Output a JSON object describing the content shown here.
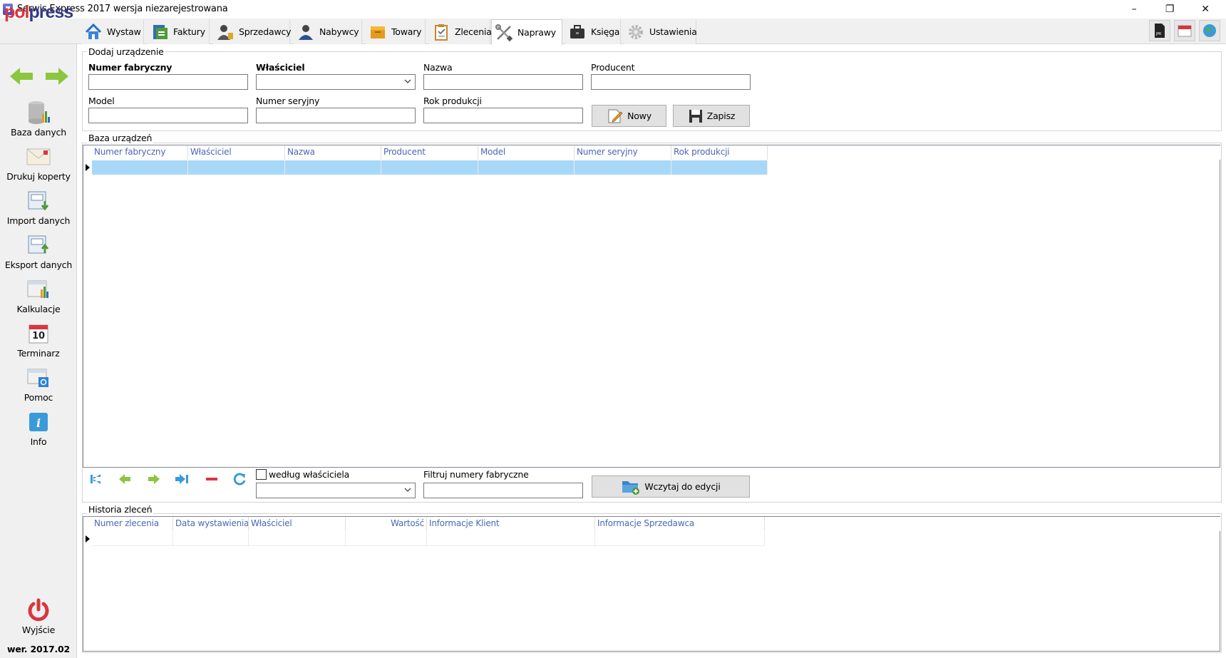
{
  "window": {
    "title": "Serwis Express 2017 wersja niezarejestrowana",
    "controls": {
      "minimize": "–",
      "restore": "❐",
      "close": "✕"
    }
  },
  "logo": {
    "part1": "pol",
    "part2": "press"
  },
  "tabs": [
    {
      "label": "Wystaw",
      "icon": "home-icon"
    },
    {
      "label": "Faktury",
      "icon": "invoice-icon"
    },
    {
      "label": "Sprzedawcy",
      "icon": "seller-icon"
    },
    {
      "label": "Nabywcy",
      "icon": "buyer-icon"
    },
    {
      "label": "Towary",
      "icon": "goods-icon"
    },
    {
      "label": "Zlecenia",
      "icon": "clipboard-icon"
    },
    {
      "label": "Naprawy",
      "icon": "tools-icon",
      "active": true
    },
    {
      "label": "Księga",
      "icon": "briefcase-icon"
    },
    {
      "label": "Ustawienia",
      "icon": "gear-icon"
    }
  ],
  "top_right_icons": [
    "jpk-icon",
    "calendar-icon",
    "globe-icon"
  ],
  "sidebar": {
    "items": [
      {
        "label": "Baza danych",
        "icon": "database-icon"
      },
      {
        "label": "Drukuj koperty",
        "icon": "envelope-icon"
      },
      {
        "label": "Import danych",
        "icon": "import-icon"
      },
      {
        "label": "Eksport danych",
        "icon": "export-icon"
      },
      {
        "label": "Kalkulacje",
        "icon": "calculator-icon"
      },
      {
        "label": "Terminarz",
        "icon": "calendar-day-icon",
        "day": "10"
      },
      {
        "label": "Pomoc",
        "icon": "help-icon"
      },
      {
        "label": "Info",
        "icon": "info-icon"
      }
    ],
    "exit_label": "Wyjście",
    "version": "wer. 2017.02"
  },
  "add_device": {
    "title": "Dodaj urządzenie",
    "fields": {
      "serial_factory": {
        "label": "Numer fabryczny",
        "value": ""
      },
      "owner": {
        "label": "Właściciel",
        "value": ""
      },
      "name": {
        "label": "Nazwa",
        "value": ""
      },
      "producer": {
        "label": "Producent",
        "value": ""
      },
      "model": {
        "label": "Model",
        "value": ""
      },
      "serial_number": {
        "label": "Numer seryjny",
        "value": ""
      },
      "production_year": {
        "label": "Rok produkcji",
        "value": ""
      }
    },
    "new_button": "Nowy",
    "save_button": "Zapisz"
  },
  "device_db": {
    "title": "Baza urządzeń",
    "columns": [
      "Numer fabryczny",
      "Właściciel",
      "Nazwa",
      "Producent",
      "Model",
      "Numer seryjny",
      "Rok produkcji"
    ],
    "rows": [
      [
        "",
        "",
        "",
        "",
        "",
        "",
        ""
      ]
    ],
    "filter_by_owner_label": "według właściciela",
    "filter_by_owner_checked": false,
    "owner_filter_value": "",
    "filter_serial_label": "Filtruj numery fabryczne",
    "filter_serial_value": "",
    "load_button": "Wczytaj do edycji"
  },
  "order_history": {
    "title": "Historia zleceń",
    "columns": [
      "Numer zlecenia",
      "Data wystawienia",
      "Właściciel",
      "Wartość",
      "Informacje Klient",
      "Informacje Sprzedawca"
    ],
    "rows": [
      [
        "",
        "",
        "",
        "",
        "",
        ""
      ]
    ]
  },
  "colors": {
    "selected_row": "#a8d8f8",
    "header_text": "#4a68b3",
    "logo_red": "#d8363f",
    "logo_blue": "#333b86"
  }
}
